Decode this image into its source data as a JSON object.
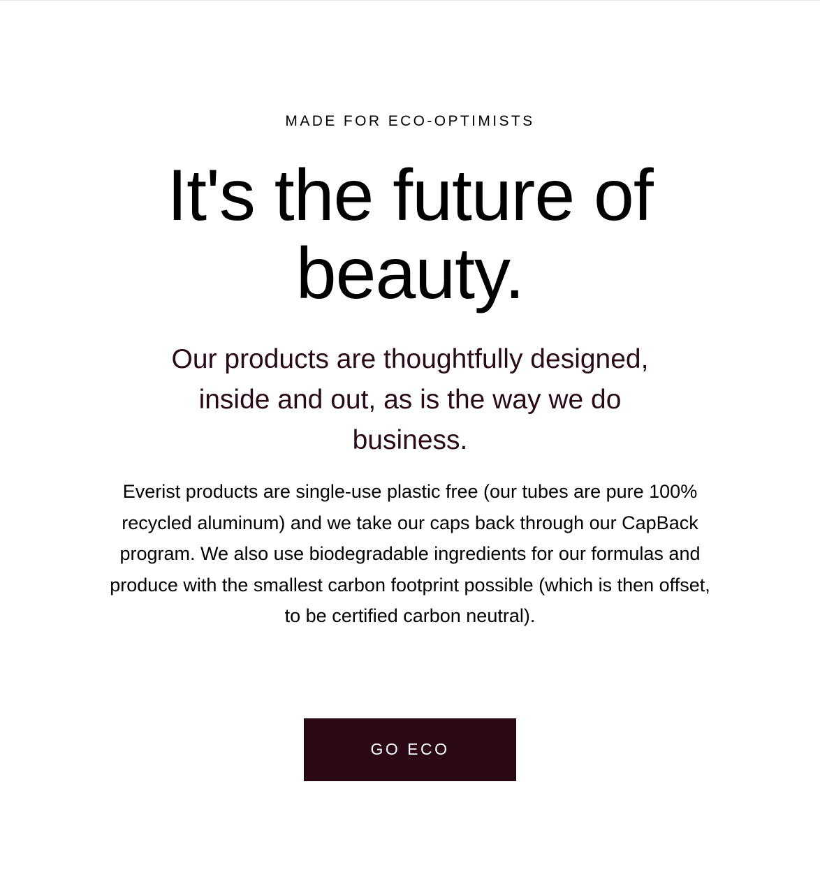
{
  "hero": {
    "eyebrow": "MADE FOR ECO-OPTIMISTS",
    "headline": "It's the future of beauty.",
    "subhead": "Our products are thoughtfully designed, inside and out, as is the way we do business.",
    "body": "Everist products are single-use plastic free (our tubes are pure 100% recycled aluminum) and we take our caps back through our CapBack program. We also use biodegradable ingredients for our formulas and produce with the smallest carbon footprint possible (which is then offset, to be certified carbon neutral).",
    "cta_label": "GO ECO"
  },
  "colors": {
    "accent": "#2b0816",
    "subhead_text": "#2a0a18",
    "background": "#ffffff"
  }
}
